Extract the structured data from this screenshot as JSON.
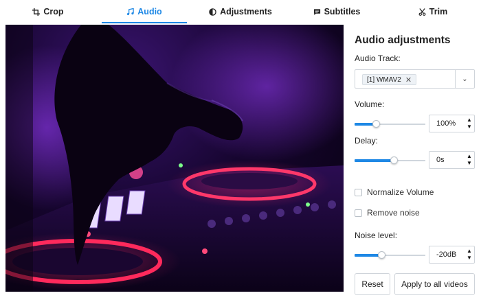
{
  "tabs": [
    {
      "label": "Crop",
      "icon": "crop-icon"
    },
    {
      "label": "Audio",
      "icon": "music-note-icon",
      "active": true
    },
    {
      "label": "Adjustments",
      "icon": "contrast-icon"
    },
    {
      "label": "Subtitles",
      "icon": "subtitles-icon"
    },
    {
      "label": "Trim",
      "icon": "scissors-icon"
    }
  ],
  "accent_color": "#1e88e5",
  "panel": {
    "title": "Audio adjustments",
    "audio_track": {
      "label": "Audio Track:",
      "selected_chip": "[1] WMAV2",
      "remove_glyph": "✕",
      "caret": "⌄"
    },
    "volume": {
      "label": "Volume:",
      "value": "100%",
      "slider_fraction": 0.3
    },
    "delay": {
      "label": "Delay:",
      "value": "0s",
      "slider_fraction": 0.55
    },
    "normalize_volume": {
      "label": "Normalize Volume",
      "checked": false
    },
    "remove_noise": {
      "label": "Remove noise",
      "checked": false
    },
    "noise_level": {
      "label": "Noise level:",
      "value": "-20dB",
      "slider_fraction": 0.38
    },
    "reset_label": "Reset",
    "apply_all_label": "Apply to all videos"
  }
}
